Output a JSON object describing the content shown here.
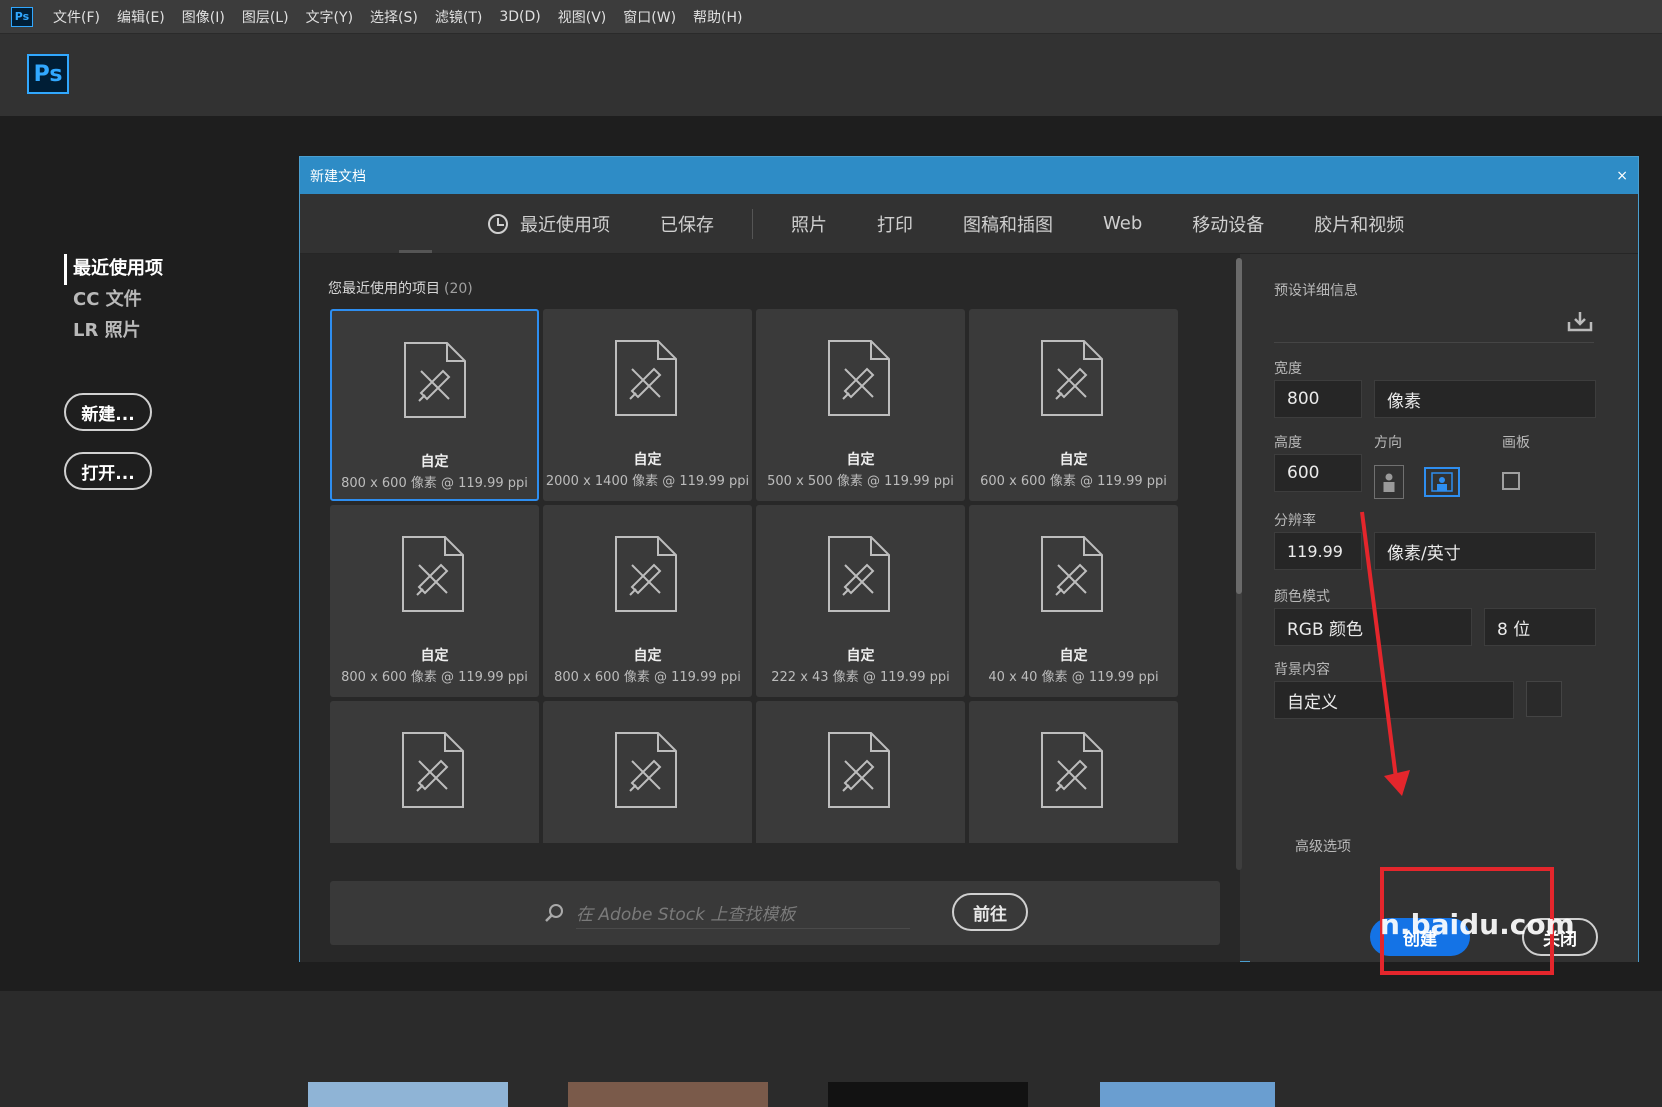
{
  "app": {
    "mini_logo": "Ps",
    "logo": "Ps",
    "menu": [
      "文件(F)",
      "编辑(E)",
      "图像(I)",
      "图层(L)",
      "文字(Y)",
      "选择(S)",
      "滤镜(T)",
      "3D(D)",
      "视图(V)",
      "窗口(W)",
      "帮助(H)"
    ]
  },
  "home": {
    "nav": [
      "最近使用项",
      "CC 文件",
      "LR 照片"
    ],
    "new_button": "新建...",
    "open_button": "打开..."
  },
  "dialog": {
    "title": "新建文档",
    "close": "×",
    "tabs": [
      "最近使用项",
      "已保存",
      "照片",
      "打印",
      "图稿和插图",
      "Web",
      "移动设备",
      "胶片和视频"
    ],
    "recent_label": "您最近使用的项目",
    "recent_count": "(20)",
    "presets": [
      {
        "name": "自定",
        "desc": "800 x 600 像素 @ 119.99 ppi"
      },
      {
        "name": "自定",
        "desc": "2000 x 1400 像素 @ 119.99 ppi"
      },
      {
        "name": "自定",
        "desc": "500 x 500 像素 @ 119.99 ppi"
      },
      {
        "name": "自定",
        "desc": "600 x 600 像素 @ 119.99 ppi"
      },
      {
        "name": "自定",
        "desc": "800 x 600 像素 @ 119.99 ppi"
      },
      {
        "name": "自定",
        "desc": "800 x 600 像素 @ 119.99 ppi"
      },
      {
        "name": "自定",
        "desc": "222 x 43 像素 @ 119.99 ppi"
      },
      {
        "name": "自定",
        "desc": "40 x 40 像素 @ 119.99 ppi"
      },
      {
        "name": "",
        "desc": ""
      },
      {
        "name": "",
        "desc": ""
      },
      {
        "name": "",
        "desc": ""
      },
      {
        "name": "",
        "desc": ""
      }
    ],
    "stock_placeholder": "在 Adobe Stock 上查找模板",
    "go_button": "前往",
    "details": {
      "header": "预设详细信息",
      "width_label": "宽度",
      "width_value": "800",
      "width_unit": "像素",
      "height_label": "高度",
      "height_value": "600",
      "orientation_label": "方向",
      "artboard_label": "画板",
      "resolution_label": "分辨率",
      "resolution_value": "119.99",
      "resolution_unit": "像素/英寸",
      "color_mode_label": "颜色模式",
      "color_mode_value": "RGB 颜色",
      "bit_depth": "8 位",
      "background_label": "背景内容",
      "background_value": "自定义",
      "advanced": "高级选项",
      "create_button": "创建",
      "close_button": "关闭"
    }
  },
  "watermark": "n.baidu.com",
  "colors": {
    "accent": "#1473e6",
    "title_bar": "#2e8cc6",
    "annotation": "#e4262c"
  }
}
